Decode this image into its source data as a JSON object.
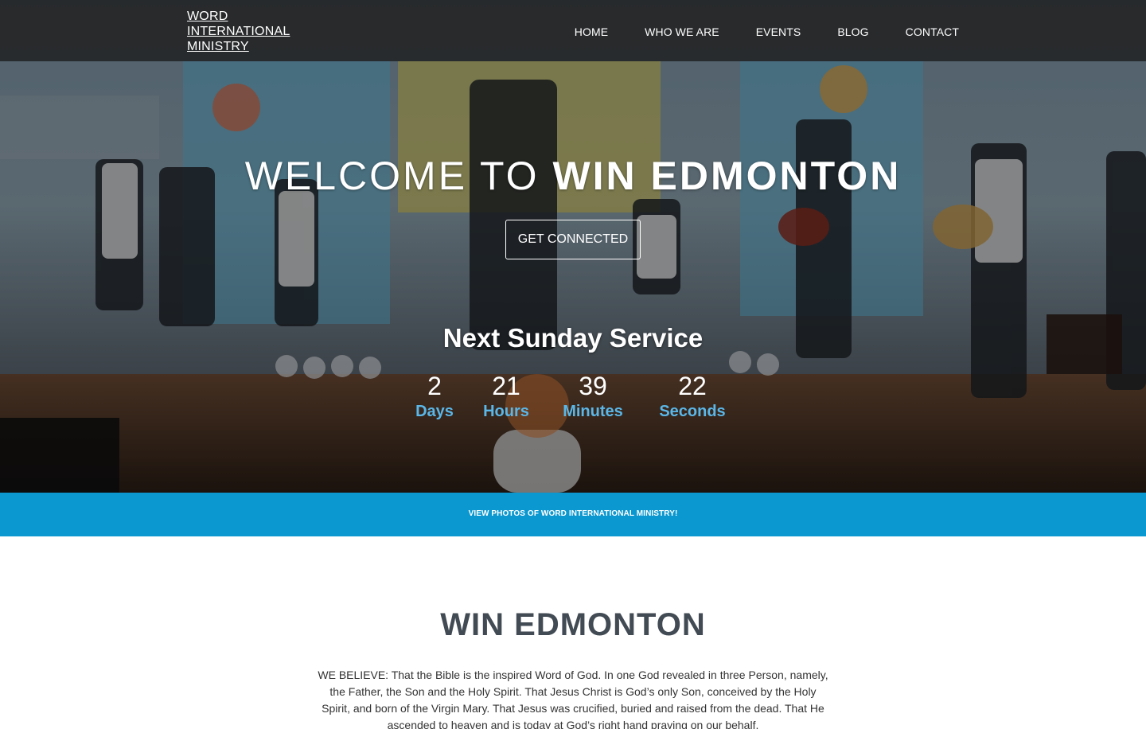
{
  "nav": {
    "logo_lines": [
      "WORD",
      "INTERNATIONAL",
      "MINISTRY"
    ],
    "links": [
      "HOME",
      "WHO WE ARE",
      "EVENTS",
      "BLOG",
      "CONTACT"
    ]
  },
  "hero": {
    "title_light": "WELCOME TO",
    "title_bold": "WIN EDMONTON",
    "cta_label": "GET CONNECTED",
    "service_title": "Next Sunday Service",
    "countdown": [
      {
        "value": "2",
        "label": "Days"
      },
      {
        "value": "21",
        "label": "Hours"
      },
      {
        "value": "39",
        "label": "Minutes"
      },
      {
        "value": "22",
        "label": "Seconds"
      }
    ]
  },
  "strip": {
    "link_label": "VIEW PHOTOS OF WORD INTERNATIONAL MINISTRY!"
  },
  "about": {
    "title": "WIN EDMONTON",
    "text": "WE BELIEVE: That the Bible is the inspired Word of God. In one God revealed in three Person, namely, the Father, the Son and the Holy Spirit. That Jesus Christ is God’s only Son, conceived by the Holy Spirit, and born of the Virgin Mary. That Jesus was crucified, buried and raised from the dead. That He ascended to heaven and is today at God’s right hand praying on our behalf."
  },
  "colors": {
    "accent_blue": "#0b97cf",
    "countdown_label": "#5ab7e8",
    "heading_dark": "#424a53"
  }
}
